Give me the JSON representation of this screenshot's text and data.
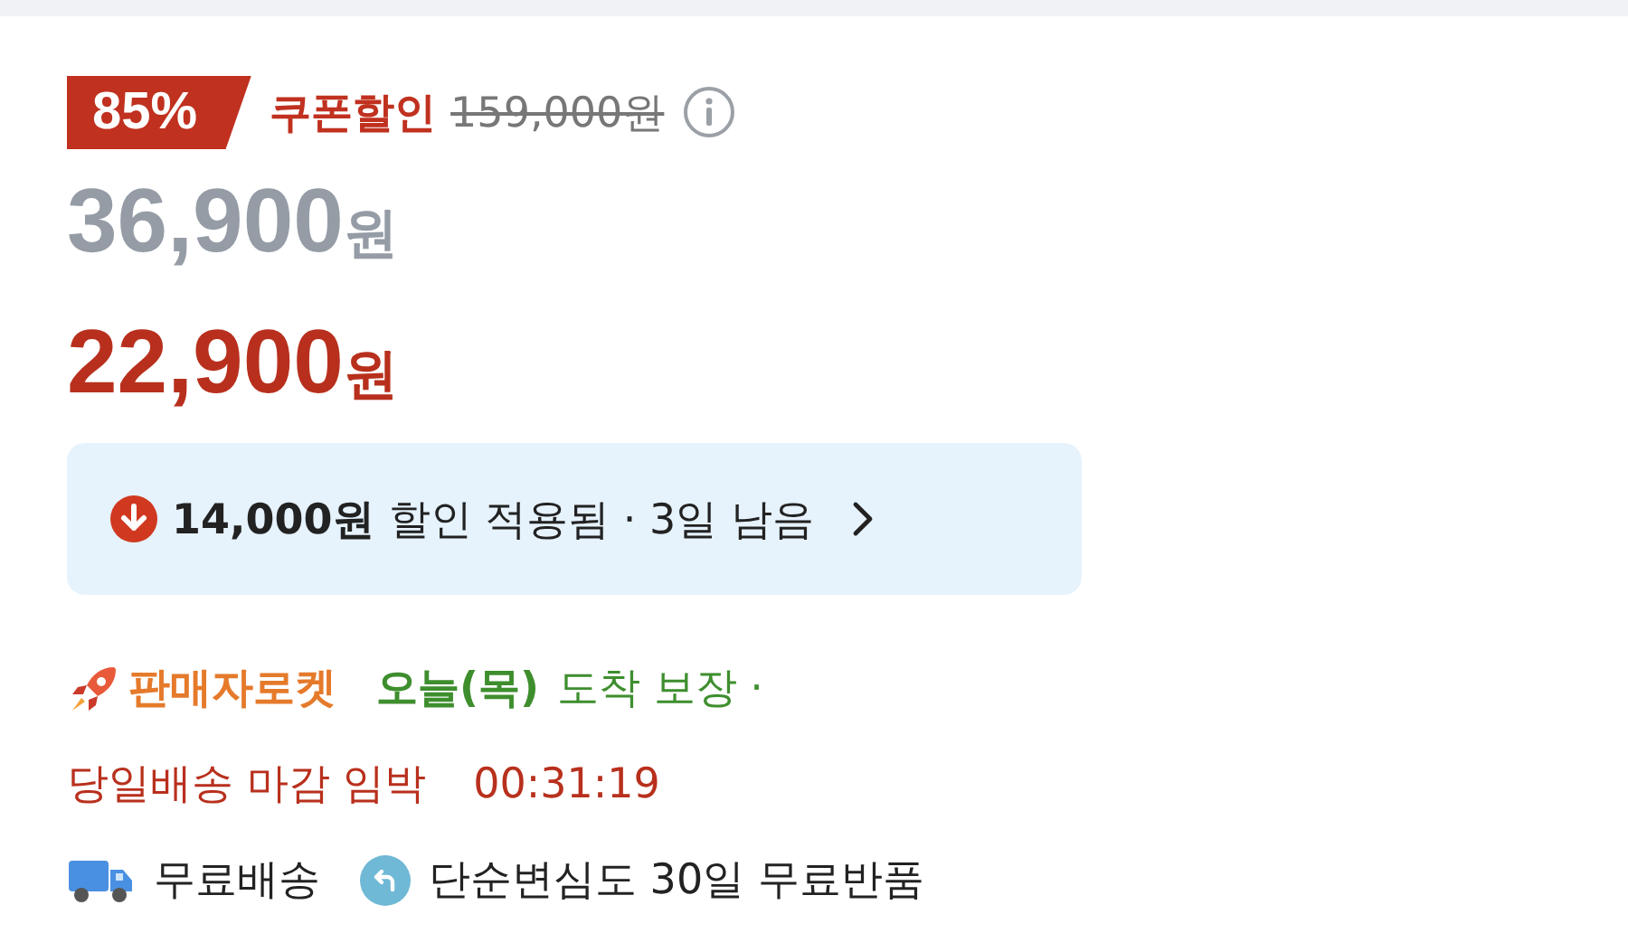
{
  "discount": {
    "badge": "85%",
    "label": "쿠폰할인",
    "original_price": "159,000원"
  },
  "price": {
    "amount": "36,900",
    "unit": "원"
  },
  "final_price": {
    "amount": "22,900",
    "unit": "원"
  },
  "coupon_bar": {
    "amount": "14,000원",
    "text": "할인 적용됨 · 3일 남음"
  },
  "delivery": {
    "badge": "판매자로켓",
    "day": "오늘(목)",
    "guarantee": "도착 보장 ·",
    "cutoff": "당일배송 마감 임박",
    "countdown": "00:31:19"
  },
  "benefits": [
    {
      "kind": "shipping",
      "label": "무료배송"
    },
    {
      "kind": "return",
      "label": "단순변심도 30일 무료반품"
    }
  ]
}
